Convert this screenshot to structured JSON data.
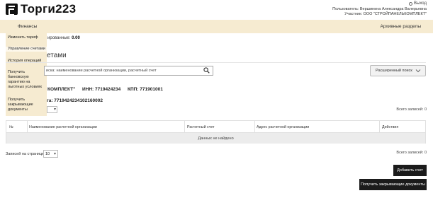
{
  "header": {
    "logo_text": "Торги223",
    "exit_label": "Выход",
    "user_line": "Пользователь: Вершинина Александра Валерьевна",
    "party_line": "Участник: ООО \"СТРОЙПАНЕЛЬКОМПЛЕКТ\""
  },
  "nav": {
    "finance": "Финансы",
    "archive": "Архивные разделы"
  },
  "dropdown": {
    "items": [
      "Изменить тариф",
      "Управление счетами",
      "История операций",
      "Получить",
      "банковскую",
      "гарантию на",
      "льготных условиях",
      "Получить",
      "закрывающие",
      "документы"
    ]
  },
  "main": {
    "blocked_prefix": "ированные:",
    "blocked_value": "0.00",
    "title": "етами",
    "search_value": "иска: наименование расчетной организации, расчетный счет",
    "advanced_search": "Расширенный поиск",
    "company_name": "КОМПЛЕКТ\"",
    "inn": "ИНН: 7719424234",
    "kpp": "КПП: 771901001",
    "ogrn": "га: 7719424234102160002",
    "total_top": "Всего записей: 0",
    "total_bottom": "Всего записей: 0",
    "per_page_label": "Записей на странице:",
    "per_page_value": "10",
    "add_account": "Добавить счет",
    "get_docs": "Получить закрывающие документы"
  },
  "table": {
    "headers": [
      "№",
      "Наименование расчетной организации",
      "Расчетный счет",
      "Адрес расчетной организации",
      "Действия"
    ],
    "empty_text": "Данных не найдено"
  },
  "colors": {
    "nav_bg": "#f6ebd1",
    "button_dark": "#1b1b1b"
  }
}
